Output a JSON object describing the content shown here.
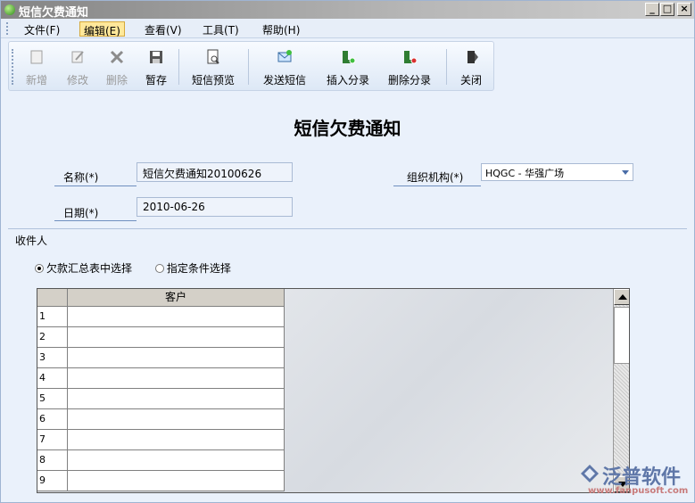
{
  "window": {
    "title": "短信欠费通知",
    "min": "_",
    "max": "□",
    "close": "×"
  },
  "menu": [
    {
      "label": "文件(F)",
      "active": false
    },
    {
      "label": "编辑(E)",
      "active": true
    },
    {
      "label": "查看(V)",
      "active": false
    },
    {
      "label": "工具(T)",
      "active": false
    },
    {
      "label": "帮助(H)",
      "active": false
    }
  ],
  "toolbar": [
    {
      "label": "新增",
      "icon": "new-icon",
      "disabled": true
    },
    {
      "label": "修改",
      "icon": "edit-icon",
      "disabled": true
    },
    {
      "label": "删除",
      "icon": "delete-icon",
      "disabled": true
    },
    {
      "label": "暂存",
      "icon": "save-icon",
      "disabled": false
    },
    {
      "label": "短信预览",
      "icon": "preview-icon",
      "disabled": false
    },
    {
      "label": "发送短信",
      "icon": "send-sms-icon",
      "disabled": false
    },
    {
      "label": "插入分录",
      "icon": "insert-row-icon",
      "disabled": false
    },
    {
      "label": "删除分录",
      "icon": "delete-row-icon",
      "disabled": false
    },
    {
      "label": "关闭",
      "icon": "close-door-icon",
      "disabled": false
    }
  ],
  "form": {
    "title": "短信欠费通知",
    "name_label": "名称(*)",
    "name_value": "短信欠费通知20100626",
    "org_label": "组织机构(*)",
    "org_value": "HQGC - 华强广场",
    "date_label": "日期(*)",
    "date_value": "2010-06-26"
  },
  "recipients": {
    "section_title": "收件人",
    "radio1": "欠款汇总表中选择",
    "radio2": "指定条件选择",
    "selected": 1
  },
  "grid": {
    "column": "客户",
    "rows": [
      "1",
      "2",
      "3",
      "4",
      "5",
      "6",
      "7",
      "8",
      "9"
    ]
  },
  "watermark": {
    "text": "泛普软件",
    "url": "www.fanpusoft.com"
  }
}
